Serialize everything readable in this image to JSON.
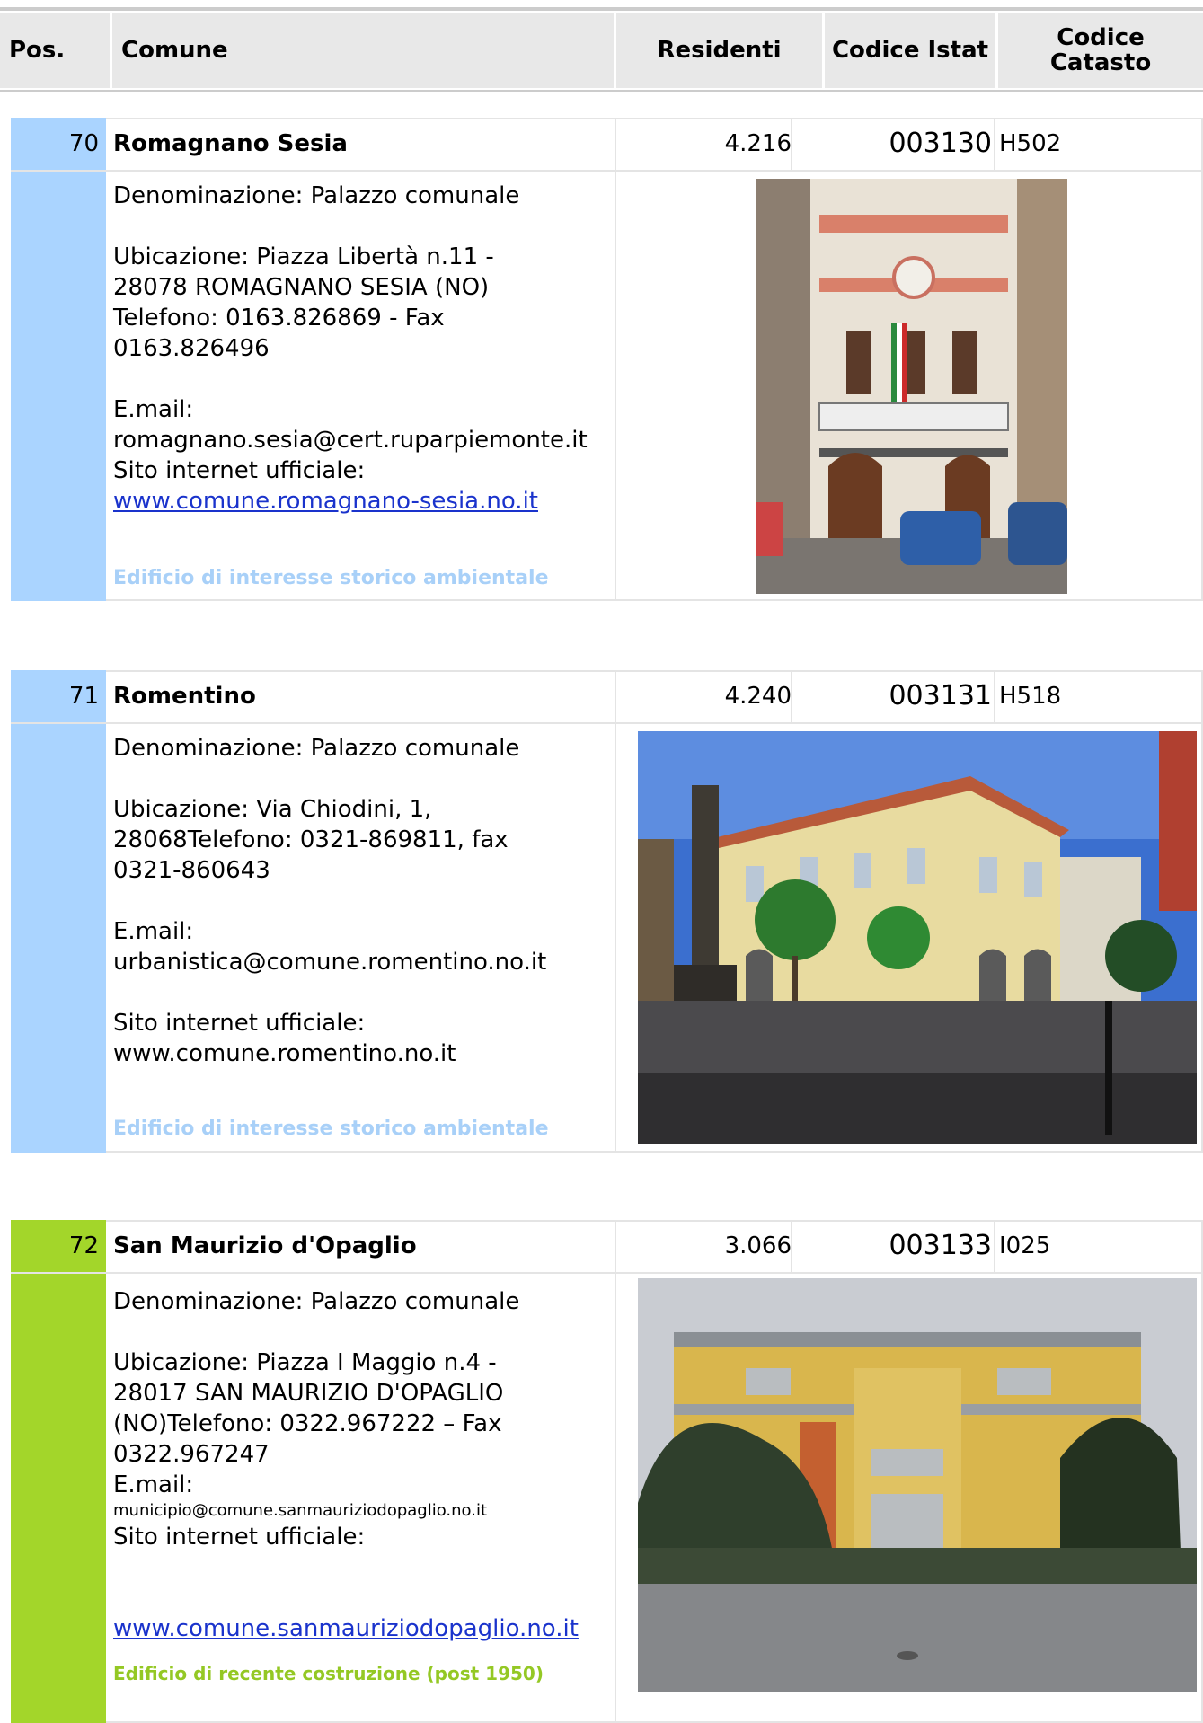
{
  "header": {
    "pos": "Pos.",
    "comune": "Comune",
    "residenti": "Residenti",
    "istat": "Codice Istat",
    "catasto_l1": "Codice",
    "catasto_l2": "Catasto"
  },
  "colors": {
    "historic_side": "#aad4ff",
    "historic_tag": "#a8d0f8",
    "recent_side": "#a3d62a",
    "recent_tag": "#94c824",
    "border": "#e4e4e4",
    "header_bg": "#e8e8e8",
    "link": "#1a33cc"
  },
  "entries": [
    {
      "pos": "70",
      "name": "Romagnano Sesia",
      "residenti": "4.216",
      "istat": "003130",
      "catasto": "H502",
      "denominazione": "Denominazione: Palazzo comunale",
      "ubicazione": "Ubicazione: Piazza Libertà n.11 - 28078 ROMAGNANO SESIA (NO) Telefono: 0163.826869 - Fax 0163.826496",
      "email_label": "E.mail:",
      "email": "romagnano.sesia@cert.ruparpiemonte.it",
      "sito_label": "Sito internet ufficiale:",
      "sito": "www.comune.romagnano-sesia.no.it",
      "tag": "Edificio di interesse storico ambientale",
      "photo_icon": "town-hall-photo"
    },
    {
      "pos": "71",
      "name": "Romentino",
      "residenti": "4.240",
      "istat": "003131",
      "catasto": "H518",
      "denominazione": "Denominazione: Palazzo comunale",
      "ubicazione": "Ubicazione: Via Chiodini, 1, 28068Telefono: 0321-869811, fax 0321-860643",
      "email_label": "E.mail:",
      "email": "urbanistica@comune.romentino.no.it",
      "sito_label": "Sito internet ufficiale:",
      "sito": "www.comune.romentino.no.it",
      "tag": "Edificio di interesse storico ambientale",
      "photo_icon": "town-hall-photo"
    },
    {
      "pos": "72",
      "name": "San Maurizio d'Opaglio",
      "residenti": "3.066",
      "istat": "003133",
      "catasto": "I025",
      "denominazione": "Denominazione: Palazzo comunale",
      "ubicazione": "Ubicazione: Piazza I Maggio n.4 - 28017 SAN MAURIZIO D'OPAGLIO (NO)Telefono: 0322.967222 – Fax 0322.967247",
      "email_label": "E.mail:",
      "email": "municipio@comune.sanmauriziodopaglio.no.it",
      "sito_label": "Sito internet ufficiale:",
      "sito": "www.comune.sanmauriziodopaglio.no.it",
      "tag": "Edificio di recente costruzione (post 1950)",
      "photo_icon": "town-hall-photo"
    }
  ]
}
